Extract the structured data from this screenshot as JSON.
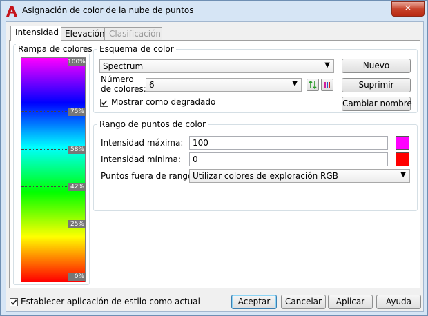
{
  "window": {
    "title": "Asignación de color de la nube de puntos",
    "close_label": "✕"
  },
  "tabs": [
    {
      "label": "Intensidad",
      "state": "active"
    },
    {
      "label": "Elevación",
      "state": "normal"
    },
    {
      "label": "Clasificación",
      "state": "disabled"
    }
  ],
  "ramp": {
    "title": "Rampa de colores",
    "ticks": [
      "100%",
      "75%",
      "58%",
      "42%",
      "25%",
      "0%"
    ]
  },
  "scheme": {
    "title": "Esquema de color",
    "selected": "Spectrum",
    "count_label_1": "Número",
    "count_label_2": "de colores:",
    "count_value": "6",
    "gradient_label": "Mostrar como degradado",
    "gradient_checked": true,
    "buttons": {
      "new": "Nuevo",
      "delete": "Suprimir",
      "rename": "Cambiar nombre"
    }
  },
  "range": {
    "title": "Rango de puntos de color",
    "max_label": "Intensidad máxima:",
    "max_value": "100",
    "max_color": "#ff00ff",
    "min_label": "Intensidad mínima:",
    "min_value": "0",
    "min_color": "#ff0000",
    "outside_label": "Puntos fuera de rango:",
    "outside_value": "Utilizar colores de exploración RGB"
  },
  "footer": {
    "set_current_label": "Establecer aplicación de estilo como actual",
    "set_current_checked": true,
    "buttons": {
      "ok": "Aceptar",
      "cancel": "Cancelar",
      "apply": "Aplicar",
      "help": "Ayuda"
    }
  }
}
